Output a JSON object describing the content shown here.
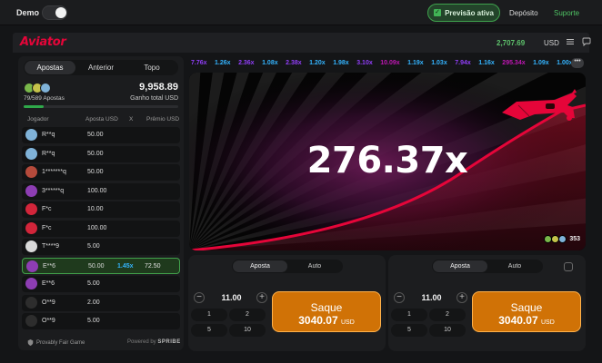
{
  "topbar": {
    "demo_label": "Demo",
    "previsao_label": "Previsão ativa",
    "deposito_label": "Depósito",
    "suporte_label": "Suporte"
  },
  "header": {
    "logo": "Aviator",
    "balance": "2,707.69",
    "currency": "USD"
  },
  "left": {
    "tabs": [
      "Apostas",
      "Anterior",
      "Topo"
    ],
    "bets_count": "79/589 Apostas",
    "total_win": "9,958.89",
    "total_label": "Ganho total USD",
    "progress": 0.13,
    "columns": [
      "Jogador",
      "Aposta USD",
      "X",
      "Prêmio USD"
    ],
    "rows": [
      {
        "user": "R**q",
        "bet": "50.00",
        "mult": "",
        "prize": "",
        "color": "#7fb2d8"
      },
      {
        "user": "R**q",
        "bet": "50.00",
        "mult": "",
        "prize": "",
        "color": "#7fb2d8"
      },
      {
        "user": "1*******q",
        "bet": "50.00",
        "mult": "",
        "prize": "",
        "color": "#b54a3b"
      },
      {
        "user": "3******q",
        "bet": "100.00",
        "mult": "",
        "prize": "",
        "color": "#8d3db3"
      },
      {
        "user": "F*c",
        "bet": "10.00",
        "mult": "",
        "prize": "",
        "color": "#d2253a"
      },
      {
        "user": "F*c",
        "bet": "100.00",
        "mult": "",
        "prize": "",
        "color": "#d2253a"
      },
      {
        "user": "T****9",
        "bet": "5.00",
        "mult": "",
        "prize": "",
        "color": "#d9d9d9"
      },
      {
        "user": "E**6",
        "bet": "50.00",
        "mult": "1.45x",
        "prize": "72.50",
        "color": "#8d3db3",
        "win": true
      },
      {
        "user": "E**6",
        "bet": "5.00",
        "mult": "",
        "prize": "",
        "color": "#8d3db3"
      },
      {
        "user": "O**9",
        "bet": "2.00",
        "mult": "",
        "prize": "",
        "color": "#2d2d2d"
      },
      {
        "user": "O**9",
        "bet": "5.00",
        "mult": "",
        "prize": "",
        "color": "#2d2d2d"
      }
    ],
    "footer_left": "Provably Fair Game",
    "footer_powered": "Powered by",
    "footer_brand": "SPRIBE"
  },
  "history": [
    {
      "v": "7.76x",
      "c": "#913ef8"
    },
    {
      "v": "1.26x",
      "c": "#34b4ff"
    },
    {
      "v": "2.36x",
      "c": "#913ef8"
    },
    {
      "v": "1.08x",
      "c": "#34b4ff"
    },
    {
      "v": "2.38x",
      "c": "#913ef8"
    },
    {
      "v": "1.20x",
      "c": "#34b4ff"
    },
    {
      "v": "1.98x",
      "c": "#34b4ff"
    },
    {
      "v": "3.10x",
      "c": "#913ef8"
    },
    {
      "v": "10.09x",
      "c": "#c017b4"
    },
    {
      "v": "1.19x",
      "c": "#34b4ff"
    },
    {
      "v": "1.03x",
      "c": "#34b4ff"
    },
    {
      "v": "7.94x",
      "c": "#913ef8"
    },
    {
      "v": "1.16x",
      "c": "#34b4ff"
    },
    {
      "v": "295.34x",
      "c": "#c017b4"
    },
    {
      "v": "1.09x",
      "c": "#34b4ff"
    },
    {
      "v": "1.00x",
      "c": "#34b4ff"
    }
  ],
  "game": {
    "multiplier": "276.37x",
    "online_count": "353"
  },
  "bet_panels": [
    {
      "tab_bet": "Aposta",
      "tab_auto": "Auto",
      "amount": "11.00",
      "quick": [
        "1",
        "2",
        "5",
        "10"
      ],
      "cashout_label": "Saque",
      "cashout_value": "3040.07",
      "cashout_currency": "USD"
    },
    {
      "tab_bet": "Aposta",
      "tab_auto": "Auto",
      "amount": "11.00",
      "quick": [
        "1",
        "2",
        "5",
        "10"
      ],
      "cashout_label": "Saque",
      "cashout_value": "3040.07",
      "cashout_currency": "USD"
    }
  ],
  "icons": {
    "menu": "menu-icon",
    "chat": "chat-icon",
    "plane": "plane-icon"
  },
  "colors": {
    "accent_red": "#e50539",
    "green": "#41b456",
    "blue": "#34b4ff",
    "purple": "#913ef8",
    "magenta": "#c017b4",
    "orange": "#d07206"
  }
}
